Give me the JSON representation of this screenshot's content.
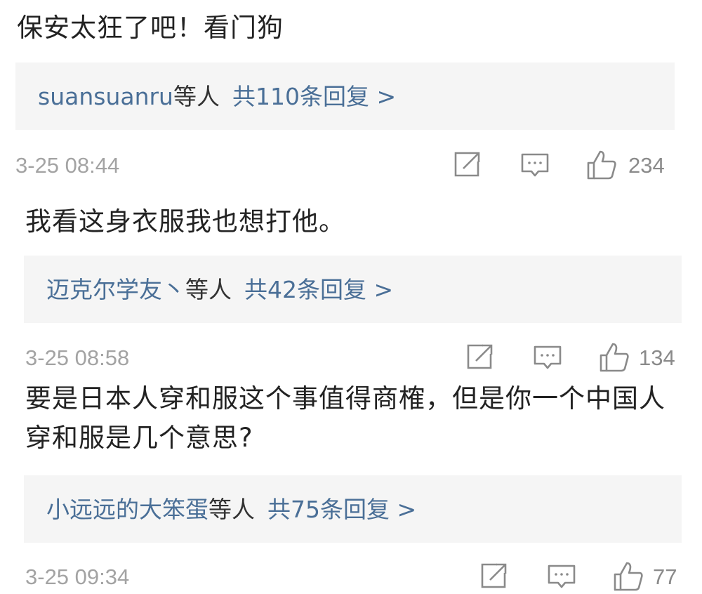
{
  "comments": [
    {
      "text": "保安太狂了吧！看门狗",
      "reply_user": "suansuanru",
      "reply_etc": "等人",
      "reply_count": "共110条回复 >",
      "time": "3-25 08:44",
      "likes": "234"
    },
    {
      "text": "我看这身衣服我也想打他。",
      "reply_user": "迈克尔学友丶",
      "reply_etc": "等人",
      "reply_count": "共42条回复 >",
      "time": "3-25 08:58",
      "likes": "134"
    },
    {
      "text": "要是日本人穿和服这个事值得商榷，但是你一个中国人穿和服是几个意思?",
      "reply_user": "小远远的大笨蛋",
      "reply_etc": "等人",
      "reply_count": "共75条回复 >",
      "time": "3-25 09:34",
      "likes": "77"
    }
  ],
  "icons": {
    "share": "share-icon",
    "reply": "comment-icon",
    "like": "thumbs-up-icon"
  },
  "colors": {
    "link": "#4a6f97",
    "meta": "#a3a3a3",
    "reply_bg": "#f5f5f5",
    "icon": "#8a8a8a"
  }
}
